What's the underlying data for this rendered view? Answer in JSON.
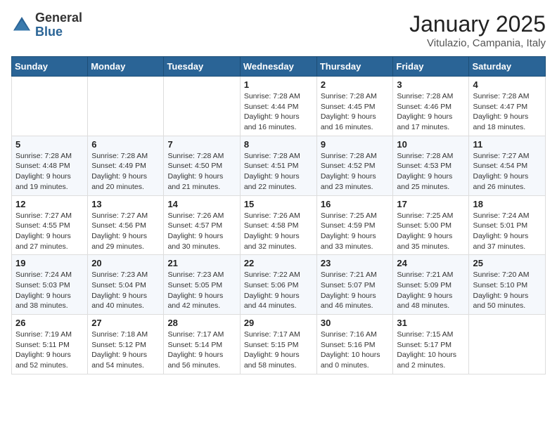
{
  "header": {
    "logo_general": "General",
    "logo_blue": "Blue",
    "month_title": "January 2025",
    "location": "Vitulazio, Campania, Italy"
  },
  "weekdays": [
    "Sunday",
    "Monday",
    "Tuesday",
    "Wednesday",
    "Thursday",
    "Friday",
    "Saturday"
  ],
  "weeks": [
    [
      null,
      null,
      null,
      {
        "day": 1,
        "sunrise": "7:28 AM",
        "sunset": "4:44 PM",
        "daylight": "9 hours and 16 minutes."
      },
      {
        "day": 2,
        "sunrise": "7:28 AM",
        "sunset": "4:45 PM",
        "daylight": "9 hours and 16 minutes."
      },
      {
        "day": 3,
        "sunrise": "7:28 AM",
        "sunset": "4:46 PM",
        "daylight": "9 hours and 17 minutes."
      },
      {
        "day": 4,
        "sunrise": "7:28 AM",
        "sunset": "4:47 PM",
        "daylight": "9 hours and 18 minutes."
      }
    ],
    [
      {
        "day": 5,
        "sunrise": "7:28 AM",
        "sunset": "4:48 PM",
        "daylight": "9 hours and 19 minutes."
      },
      {
        "day": 6,
        "sunrise": "7:28 AM",
        "sunset": "4:49 PM",
        "daylight": "9 hours and 20 minutes."
      },
      {
        "day": 7,
        "sunrise": "7:28 AM",
        "sunset": "4:50 PM",
        "daylight": "9 hours and 21 minutes."
      },
      {
        "day": 8,
        "sunrise": "7:28 AM",
        "sunset": "4:51 PM",
        "daylight": "9 hours and 22 minutes."
      },
      {
        "day": 9,
        "sunrise": "7:28 AM",
        "sunset": "4:52 PM",
        "daylight": "9 hours and 23 minutes."
      },
      {
        "day": 10,
        "sunrise": "7:28 AM",
        "sunset": "4:53 PM",
        "daylight": "9 hours and 25 minutes."
      },
      {
        "day": 11,
        "sunrise": "7:27 AM",
        "sunset": "4:54 PM",
        "daylight": "9 hours and 26 minutes."
      }
    ],
    [
      {
        "day": 12,
        "sunrise": "7:27 AM",
        "sunset": "4:55 PM",
        "daylight": "9 hours and 27 minutes."
      },
      {
        "day": 13,
        "sunrise": "7:27 AM",
        "sunset": "4:56 PM",
        "daylight": "9 hours and 29 minutes."
      },
      {
        "day": 14,
        "sunrise": "7:26 AM",
        "sunset": "4:57 PM",
        "daylight": "9 hours and 30 minutes."
      },
      {
        "day": 15,
        "sunrise": "7:26 AM",
        "sunset": "4:58 PM",
        "daylight": "9 hours and 32 minutes."
      },
      {
        "day": 16,
        "sunrise": "7:25 AM",
        "sunset": "4:59 PM",
        "daylight": "9 hours and 33 minutes."
      },
      {
        "day": 17,
        "sunrise": "7:25 AM",
        "sunset": "5:00 PM",
        "daylight": "9 hours and 35 minutes."
      },
      {
        "day": 18,
        "sunrise": "7:24 AM",
        "sunset": "5:01 PM",
        "daylight": "9 hours and 37 minutes."
      }
    ],
    [
      {
        "day": 19,
        "sunrise": "7:24 AM",
        "sunset": "5:03 PM",
        "daylight": "9 hours and 38 minutes."
      },
      {
        "day": 20,
        "sunrise": "7:23 AM",
        "sunset": "5:04 PM",
        "daylight": "9 hours and 40 minutes."
      },
      {
        "day": 21,
        "sunrise": "7:23 AM",
        "sunset": "5:05 PM",
        "daylight": "9 hours and 42 minutes."
      },
      {
        "day": 22,
        "sunrise": "7:22 AM",
        "sunset": "5:06 PM",
        "daylight": "9 hours and 44 minutes."
      },
      {
        "day": 23,
        "sunrise": "7:21 AM",
        "sunset": "5:07 PM",
        "daylight": "9 hours and 46 minutes."
      },
      {
        "day": 24,
        "sunrise": "7:21 AM",
        "sunset": "5:09 PM",
        "daylight": "9 hours and 48 minutes."
      },
      {
        "day": 25,
        "sunrise": "7:20 AM",
        "sunset": "5:10 PM",
        "daylight": "9 hours and 50 minutes."
      }
    ],
    [
      {
        "day": 26,
        "sunrise": "7:19 AM",
        "sunset": "5:11 PM",
        "daylight": "9 hours and 52 minutes."
      },
      {
        "day": 27,
        "sunrise": "7:18 AM",
        "sunset": "5:12 PM",
        "daylight": "9 hours and 54 minutes."
      },
      {
        "day": 28,
        "sunrise": "7:17 AM",
        "sunset": "5:14 PM",
        "daylight": "9 hours and 56 minutes."
      },
      {
        "day": 29,
        "sunrise": "7:17 AM",
        "sunset": "5:15 PM",
        "daylight": "9 hours and 58 minutes."
      },
      {
        "day": 30,
        "sunrise": "7:16 AM",
        "sunset": "5:16 PM",
        "daylight": "10 hours and 0 minutes."
      },
      {
        "day": 31,
        "sunrise": "7:15 AM",
        "sunset": "5:17 PM",
        "daylight": "10 hours and 2 minutes."
      },
      null
    ]
  ]
}
